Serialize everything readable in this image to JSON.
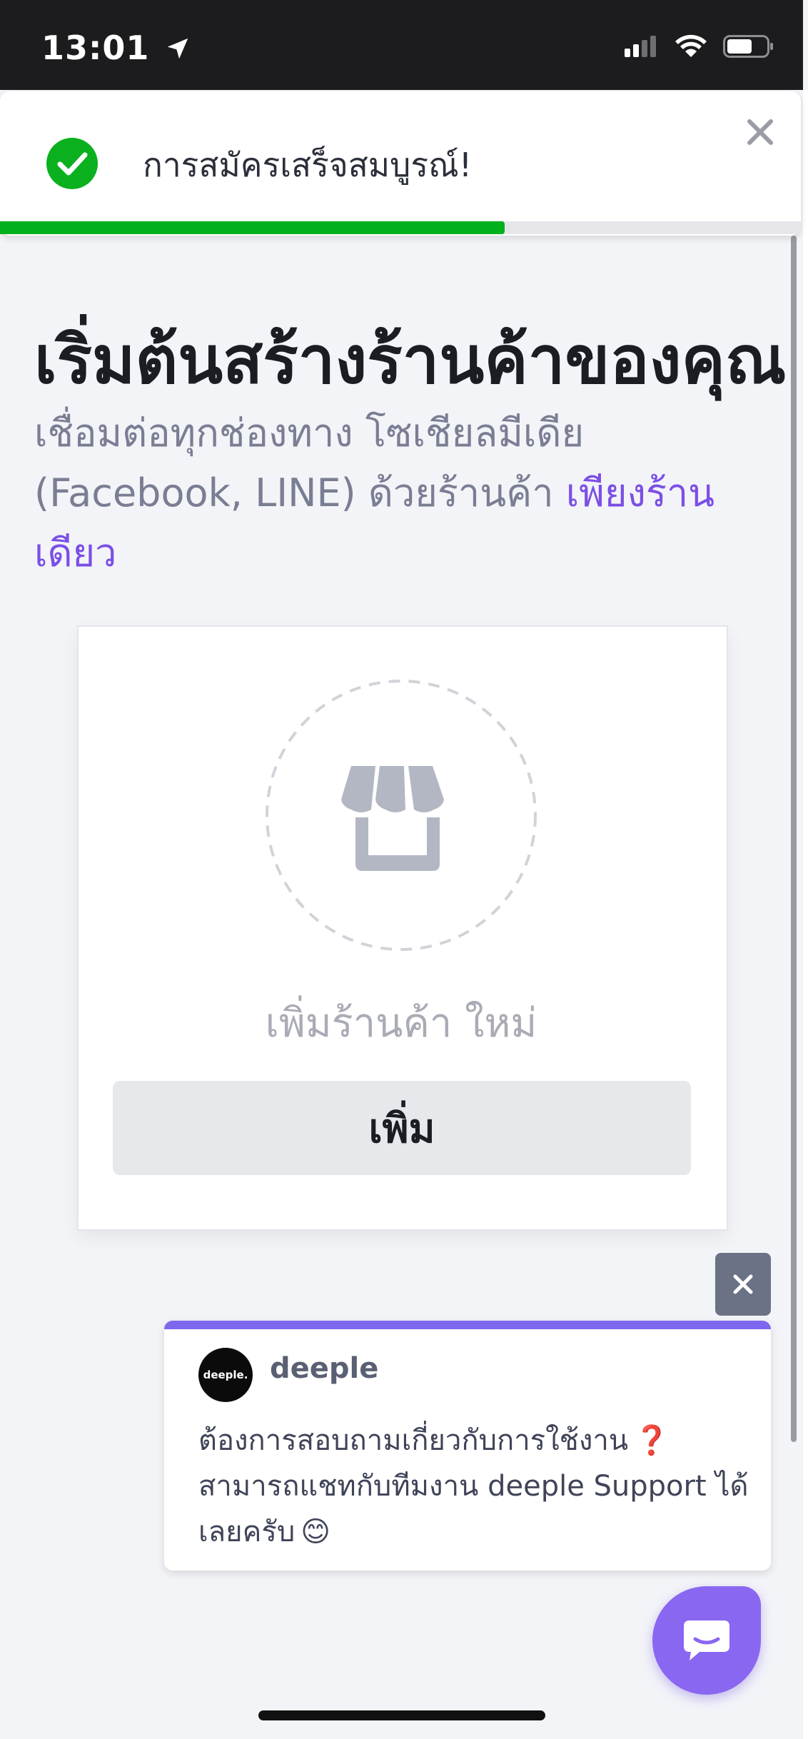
{
  "status_bar": {
    "time": "13:01",
    "icons": [
      "location-arrow-icon",
      "cellular-signal-icon",
      "wifi-icon",
      "battery-icon"
    ]
  },
  "toast": {
    "message": "การสมัครเสร็จสมบูรณ์!",
    "icon": "check-circle-icon",
    "close_icon": "close-icon",
    "progress": 0.63,
    "progress_color": "#00b01c"
  },
  "page": {
    "title": "เริ่มต้นสร้างร้านค้าของคุณ",
    "subtitle_lines": [
      "เชื่อมต่อทุกช่องทาง โซเชียลมีเดีย",
      "(Facebook, LINE) ด้วยร้านค้า "
    ],
    "subtitle_highlight": "เพียงร้าน",
    "subtitle_highlight_2": "เดียว",
    "accent_color": "#7b4fe6"
  },
  "add_store_card": {
    "icon": "store-icon",
    "label": "เพิ่มร้านค้า ใหม่",
    "button_label": "เพิ่ม"
  },
  "chat_popup": {
    "close_icon": "close-icon",
    "brand_avatar_text": "deeple.",
    "brand_name": "deeple",
    "message_lines": [
      "ต้องการสอบถามเกี่ยวกับการใช้งาน",
      "สามารถแชทกับทีมงาน deeple Support ได้",
      "เลยครับ"
    ],
    "emoji_1": "❓",
    "emoji_2": "😊",
    "accent_color": "#7c67ee"
  },
  "chat_launcher": {
    "icon": "chat-bubble-icon",
    "color": "#8a67f0"
  }
}
